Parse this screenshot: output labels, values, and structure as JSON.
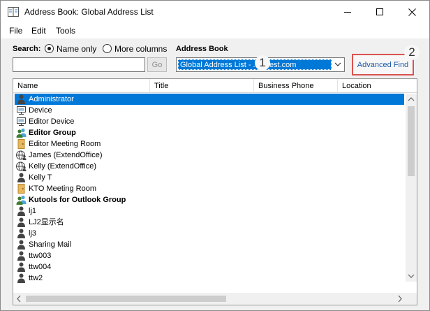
{
  "window": {
    "title": "Address Book: Global Address List"
  },
  "menu": [
    "File",
    "Edit",
    "Tools"
  ],
  "search": {
    "label": "Search:",
    "options": [
      "Name only",
      "More columns"
    ],
    "selected": "Name only",
    "input_value": "",
    "go_label": "Go"
  },
  "address_book": {
    "label": "Address Book",
    "selected_value": "Global Address List - ...@test.com"
  },
  "advanced_find_label": "Advanced Find",
  "callouts": [
    "1",
    "2"
  ],
  "columns": [
    "Name",
    "Title",
    "Business Phone",
    "Location"
  ],
  "entries": [
    {
      "name": "Administrator",
      "icon": "person-icon",
      "bold": false,
      "selected": true
    },
    {
      "name": "Device",
      "icon": "device-icon",
      "bold": false,
      "selected": false
    },
    {
      "name": "Editor Device",
      "icon": "device-icon",
      "bold": false,
      "selected": false
    },
    {
      "name": "Editor Group",
      "icon": "group-icon",
      "bold": true,
      "selected": false
    },
    {
      "name": "Editor Meeting Room",
      "icon": "room-icon",
      "bold": false,
      "selected": false
    },
    {
      "name": "James (ExtendOffice)",
      "icon": "globe-person-icon",
      "bold": false,
      "selected": false
    },
    {
      "name": "Kelly (ExtendOffice)",
      "icon": "globe-person-icon",
      "bold": false,
      "selected": false
    },
    {
      "name": "Kelly T",
      "icon": "person-icon",
      "bold": false,
      "selected": false
    },
    {
      "name": "KTO Meeting Room",
      "icon": "room-icon",
      "bold": false,
      "selected": false
    },
    {
      "name": "Kutools for Outlook Group",
      "icon": "group-icon",
      "bold": true,
      "selected": false
    },
    {
      "name": "lj1",
      "icon": "person-icon",
      "bold": false,
      "selected": false
    },
    {
      "name": "LJ2显示名",
      "icon": "person-icon",
      "bold": false,
      "selected": false
    },
    {
      "name": "lj3",
      "icon": "person-icon",
      "bold": false,
      "selected": false
    },
    {
      "name": "Sharing Mail",
      "icon": "person-icon",
      "bold": false,
      "selected": false
    },
    {
      "name": "ttw003",
      "icon": "person-icon",
      "bold": false,
      "selected": false
    },
    {
      "name": "ttw004",
      "icon": "person-icon",
      "bold": false,
      "selected": false
    },
    {
      "name": "ttw2",
      "icon": "person-icon",
      "bold": false,
      "selected": false
    }
  ],
  "colors": {
    "selection": "#0078d7",
    "callout_border": "#d9534f",
    "link_blue": "#1e5aa8"
  }
}
